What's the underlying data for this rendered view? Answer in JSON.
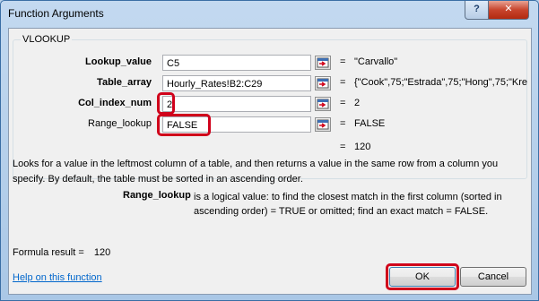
{
  "window": {
    "title": "Function Arguments",
    "help_glyph": "?",
    "close_glyph": "✕"
  },
  "function": {
    "name": "VLOOKUP"
  },
  "arguments": [
    {
      "label": "Lookup_value",
      "value": "C5",
      "result": "\"Carvallo\""
    },
    {
      "label": "Table_array",
      "value": "Hourly_Rates!B2:C29",
      "result": "{\"Cook\",75;\"Estrada\",75;\"Hong\",75;\"Kre"
    },
    {
      "label": "Col_index_num",
      "value": "2",
      "result": "2"
    },
    {
      "label": "Range_lookup",
      "value": "FALSE",
      "result": "FALSE"
    }
  ],
  "equals_sign": "=",
  "overall_result": "120",
  "description": "Looks for a value in the leftmost column of a table, and then returns a value in the same row from a column you specify. By default, the table must be sorted in an ascending order.",
  "arg_help": {
    "label": "Range_lookup",
    "text": "is a logical value: to find the closest match in the first column (sorted in ascending order) = TRUE or omitted; find an exact match = FALSE."
  },
  "formula_result": {
    "label": "Formula result =",
    "value": "120"
  },
  "help_link": "Help on this function",
  "buttons": {
    "ok": "OK",
    "cancel": "Cancel"
  },
  "colors": {
    "annotation": "#d0021b",
    "link": "#0066cc"
  },
  "icons": [
    "collapse-dialog-icon"
  ]
}
